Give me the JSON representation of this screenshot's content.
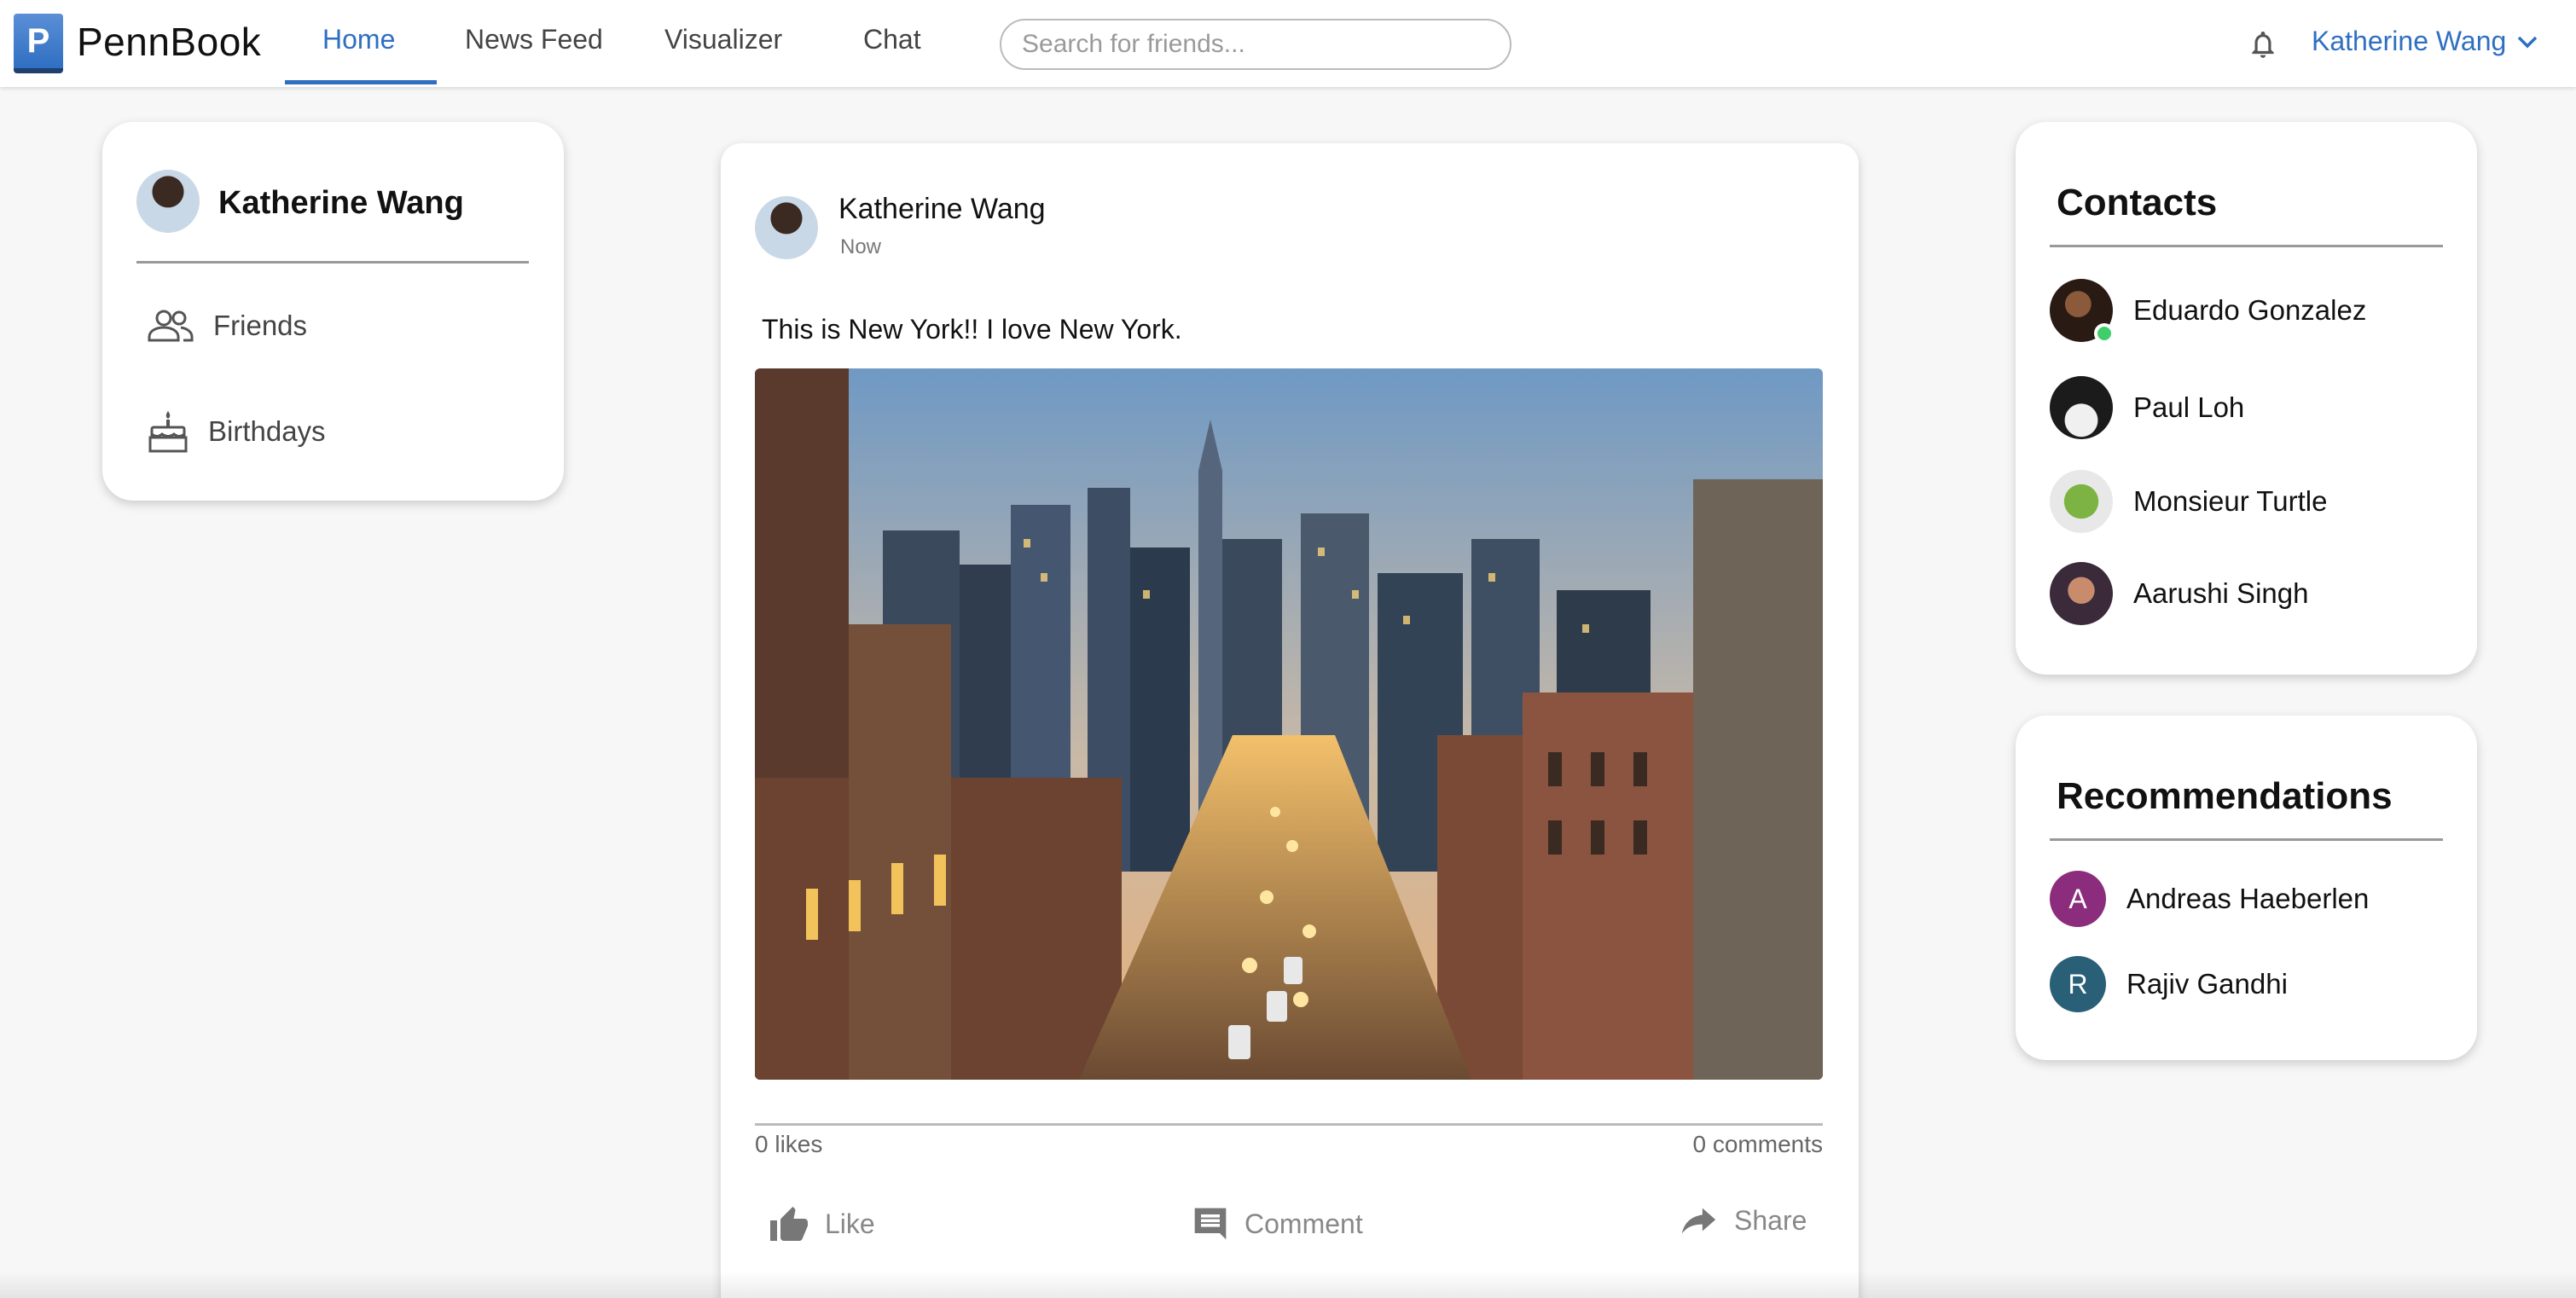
{
  "brand": {
    "logo_letter": "P",
    "name": "PennBook"
  },
  "nav": {
    "tabs": [
      {
        "label": "Home",
        "active": true
      },
      {
        "label": "News Feed",
        "active": false
      },
      {
        "label": "Visualizer",
        "active": false
      },
      {
        "label": "Chat",
        "active": false
      }
    ]
  },
  "search": {
    "placeholder": "Search for friends..."
  },
  "user_menu": {
    "name": "Katherine Wang"
  },
  "left_panel": {
    "name": "Katherine Wang",
    "items": [
      {
        "label": "Friends",
        "icon": "friends-icon"
      },
      {
        "label": "Birthdays",
        "icon": "cake-icon"
      }
    ]
  },
  "post": {
    "author": "Katherine Wang",
    "time": "Now",
    "text": "This is New York!! I love New York.",
    "likes": "0 likes",
    "comments": "0 comments",
    "actions": {
      "like": "Like",
      "comment": "Comment",
      "share": "Share"
    }
  },
  "contacts": {
    "title": "Contacts",
    "items": [
      {
        "name": "Eduardo Gonzalez",
        "online": true
      },
      {
        "name": "Paul Loh",
        "online": false
      },
      {
        "name": "Monsieur Turtle",
        "online": false
      },
      {
        "name": "Aarushi Singh",
        "online": false
      }
    ]
  },
  "recommendations": {
    "title": "Recommendations",
    "items": [
      {
        "name": "Andreas Haeberlen",
        "initial": "A",
        "color": "#8b2d7c"
      },
      {
        "name": "Rajiv Gandhi",
        "initial": "R",
        "color": "#2a5f78"
      }
    ]
  },
  "colors": {
    "accent": "#2f6fc2",
    "online": "#3ecf6b"
  }
}
